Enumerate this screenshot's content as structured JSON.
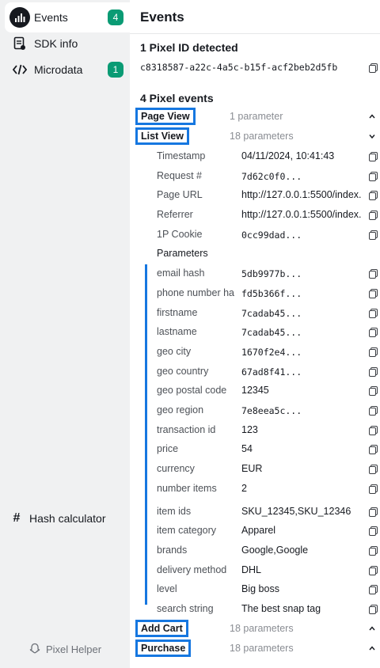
{
  "sidebar": {
    "items": [
      {
        "label": "Events",
        "icon": "bar-chart-icon",
        "badge": "4"
      },
      {
        "label": "SDK info",
        "icon": "document-icon"
      },
      {
        "label": "Microdata",
        "icon": "code-icon",
        "badge": "1"
      }
    ],
    "hash_label": "Hash calculator",
    "footer_label": "Pixel Helper"
  },
  "main": {
    "title": "Events",
    "pixel_section": "1 Pixel ID detected",
    "pixel_id": "c8318587-a22c-4a5c-b15f-acf2beb2d5fb",
    "events_section": "4 Pixel events",
    "events": [
      {
        "name": "Page View",
        "params": "1 parameter"
      },
      {
        "name": "List View",
        "params": "18 parameters"
      },
      {
        "name": "Add Cart",
        "params": "18 parameters"
      },
      {
        "name": "Purchase",
        "params": "18 parameters"
      }
    ],
    "meta_rows": [
      {
        "key": "Timestamp",
        "value": "04/11/2024, 10:41:43"
      },
      {
        "key": "Request #",
        "value": "7d62c0f0..."
      },
      {
        "key": "Page URL",
        "value": "http://127.0.0.1:5500/index."
      },
      {
        "key": "Referrer",
        "value": "http://127.0.0.1:5500/index."
      },
      {
        "key": "1P Cookie",
        "value": "0cc99dad..."
      }
    ],
    "parameters_label": "Parameters",
    "param_rows": [
      {
        "key": "email hash",
        "value": "5db9977b..."
      },
      {
        "key": "phone number ha",
        "value": "fd5b366f..."
      },
      {
        "key": "firstname",
        "value": "7cadab45..."
      },
      {
        "key": "lastname",
        "value": "7cadab45..."
      },
      {
        "key": "geo city",
        "value": "1670f2e4..."
      },
      {
        "key": "geo country",
        "value": "67ad8f41..."
      },
      {
        "key": "geo postal code",
        "value": "12345"
      },
      {
        "key": "geo region",
        "value": "7e8eea5c..."
      },
      {
        "key": "transaction id",
        "value": "123"
      },
      {
        "key": "price",
        "value": "54"
      },
      {
        "key": "currency",
        "value": "EUR"
      },
      {
        "key": "number items",
        "value": "2"
      },
      {
        "key": "item ids",
        "value": "SKU_12345,SKU_12346"
      },
      {
        "key": "item category",
        "value": "Apparel"
      },
      {
        "key": "brands",
        "value": "Google,Google"
      },
      {
        "key": "delivery method",
        "value": "DHL"
      },
      {
        "key": "level",
        "value": "Big boss"
      },
      {
        "key": "search string",
        "value": "The best snap tag"
      }
    ]
  },
  "colors": {
    "accent": "#1677e0",
    "badge": "#0a9b74"
  }
}
